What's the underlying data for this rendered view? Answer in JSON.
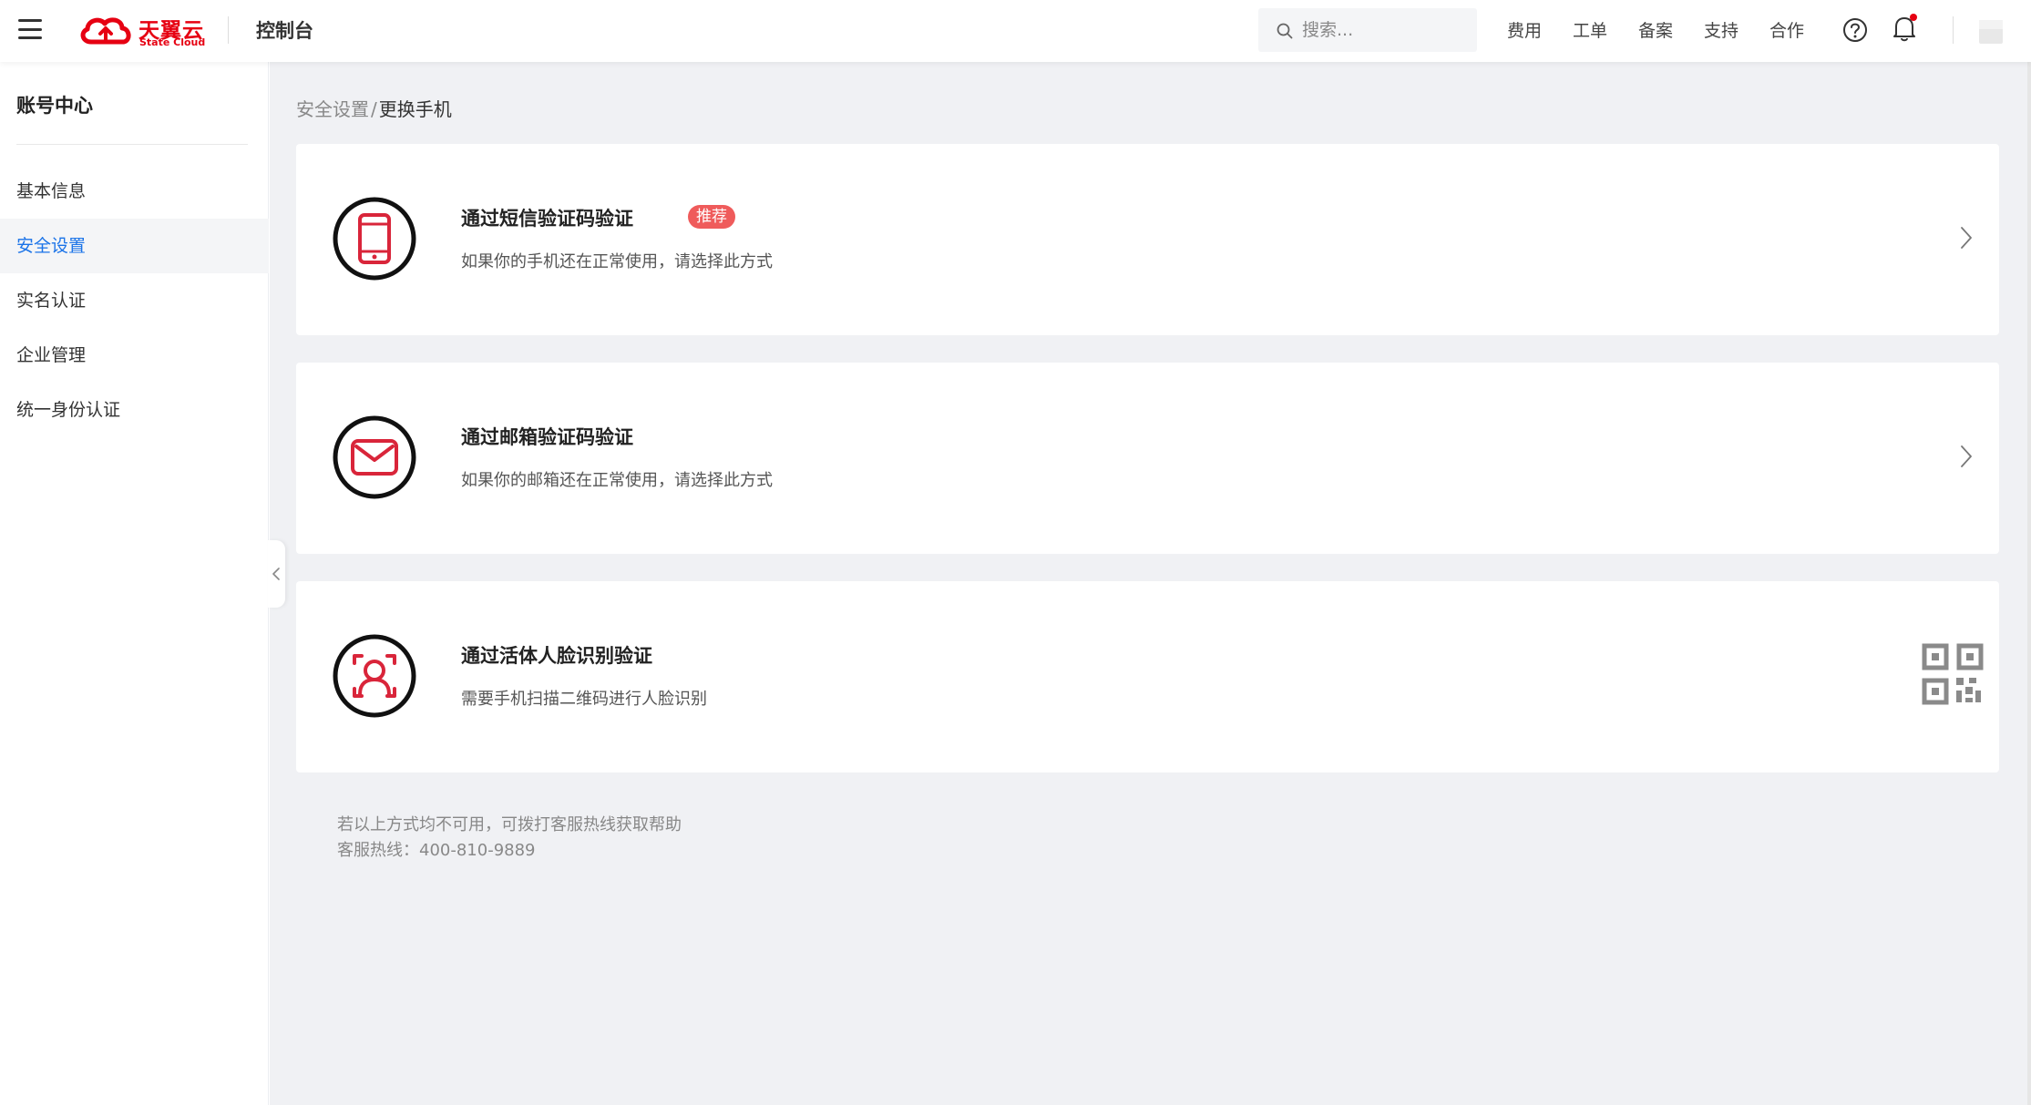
{
  "header": {
    "logo_cn": "天翼云",
    "logo_en": "State Cloud",
    "console": "控制台",
    "search_placeholder": "搜索...",
    "nav": [
      "费用",
      "工单",
      "备案",
      "支持",
      "合作"
    ]
  },
  "sidebar": {
    "title": "账号中心",
    "items": [
      {
        "label": "基本信息",
        "active": false
      },
      {
        "label": "安全设置",
        "active": true
      },
      {
        "label": "实名认证",
        "active": false
      },
      {
        "label": "企业管理",
        "active": false
      },
      {
        "label": "统一身份认证",
        "active": false
      }
    ]
  },
  "breadcrumb": {
    "parent": "安全设置",
    "separator": "/",
    "current": "更换手机"
  },
  "cards": [
    {
      "title": "通过短信验证码验证",
      "badge": "推荐",
      "desc": "如果你的手机还在正常使用，请选择此方式",
      "icon": "phone-icon",
      "action": "chevron-right-icon"
    },
    {
      "title": "通过邮箱验证码验证",
      "badge": "",
      "desc": "如果你的邮箱还在正常使用，请选择此方式",
      "icon": "mail-icon",
      "action": "chevron-right-icon"
    },
    {
      "title": "通过活体人脸识别验证",
      "badge": "",
      "desc": "需要手机扫描二维码进行人脸识别",
      "icon": "face-id-icon",
      "action": "qr-code-icon"
    }
  ],
  "footer": {
    "line1": "若以上方式均不可用，可拨打客服热线获取帮助",
    "line2": "客服热线：400-810-9889"
  },
  "colors": {
    "brand": "#e60012",
    "active_link": "#1a73e8",
    "badge": "#ef5b5b",
    "page_bg": "#f0f1f4"
  }
}
